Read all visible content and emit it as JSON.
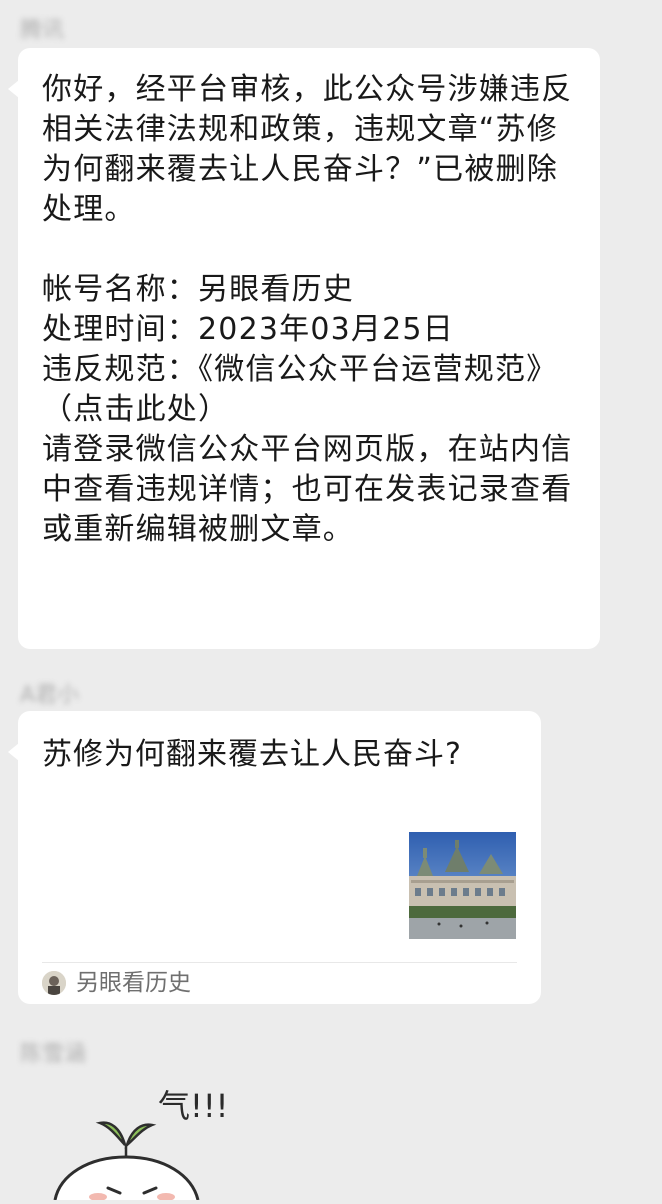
{
  "chat": {
    "messages": [
      {
        "sender": "腾讯",
        "text_paragraphs": [
          "你好，经平台审核，此公众号涉嫌违反相关法律法规和政策，违规文章“苏修为何翻来覆去让人民奋斗？”已被删除处理。",
          "",
          "帐号名称：另眼看历史",
          "处理时间：2023年03月25日",
          "违反规范：《微信公众平台运营规范》（点击此处）",
          "请登录微信公众平台网页版，在站内信中查看违规详情；也可在发表记录查看或重新编辑被删文章。"
        ]
      },
      {
        "sender": "A君小",
        "article": {
          "title": "苏修为何翻来覆去让人民奋斗?",
          "source": "另眼看历史"
        }
      },
      {
        "sender": "陈雪涵",
        "sticker": {
          "caption": "气!!!",
          "icon": "angry-sprout-sticker"
        }
      }
    ]
  },
  "colors": {
    "background": "#ececec",
    "bubble": "#ffffff",
    "text": "#191919",
    "muted": "#6f6f6f"
  }
}
